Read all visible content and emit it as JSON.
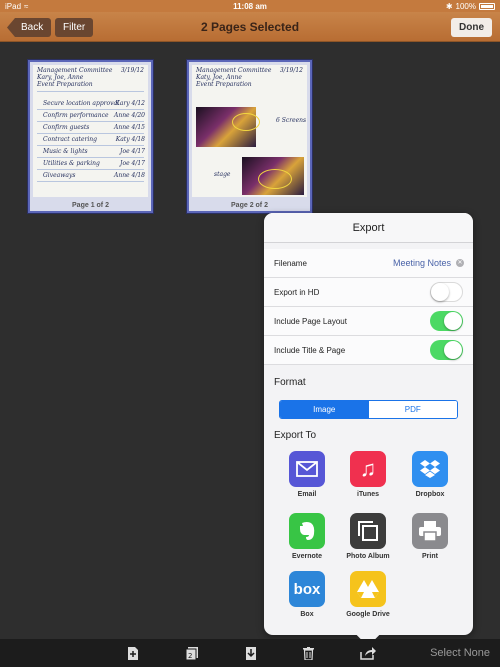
{
  "status_bar": {
    "device": "iPad",
    "time": "11:08 am",
    "battery": "100%"
  },
  "nav": {
    "back_label": "Back",
    "filter_label": "Filter",
    "title": "2 Pages Selected",
    "done_label": "Done"
  },
  "pages": [
    {
      "caption": "Page 1 of 2"
    },
    {
      "caption": "Page 2 of 2"
    }
  ],
  "export": {
    "title": "Export",
    "filename_label": "Filename",
    "filename_value": "Meeting Notes",
    "options": [
      {
        "label": "Export in HD",
        "on": false
      },
      {
        "label": "Include Page Layout",
        "on": true
      },
      {
        "label": "Include Title & Page",
        "on": true
      }
    ],
    "format_label": "Format",
    "formats": [
      "Image",
      "PDF"
    ],
    "selected_format": "Image",
    "export_to_label": "Export To",
    "targets": [
      {
        "label": "Email",
        "icon": "email-icon",
        "color": "#5656d6"
      },
      {
        "label": "iTunes",
        "icon": "itunes-icon",
        "color": "#f0304f"
      },
      {
        "label": "Dropbox",
        "icon": "dropbox-icon",
        "color": "#2f8ff0"
      },
      {
        "label": "Evernote",
        "icon": "evernote-icon",
        "color": "#38c545"
      },
      {
        "label": "Photo Album",
        "icon": "photo-album-icon",
        "color": "#3c3c3c"
      },
      {
        "label": "Print",
        "icon": "print-icon",
        "color": "#8a8a8e"
      },
      {
        "label": "Box",
        "icon": "box-icon",
        "color": "#2d86d8"
      },
      {
        "label": "Google Drive",
        "icon": "google-drive-icon",
        "color": "#f5c31c"
      }
    ]
  },
  "toolbar": {
    "select_none_label": "Select None"
  }
}
